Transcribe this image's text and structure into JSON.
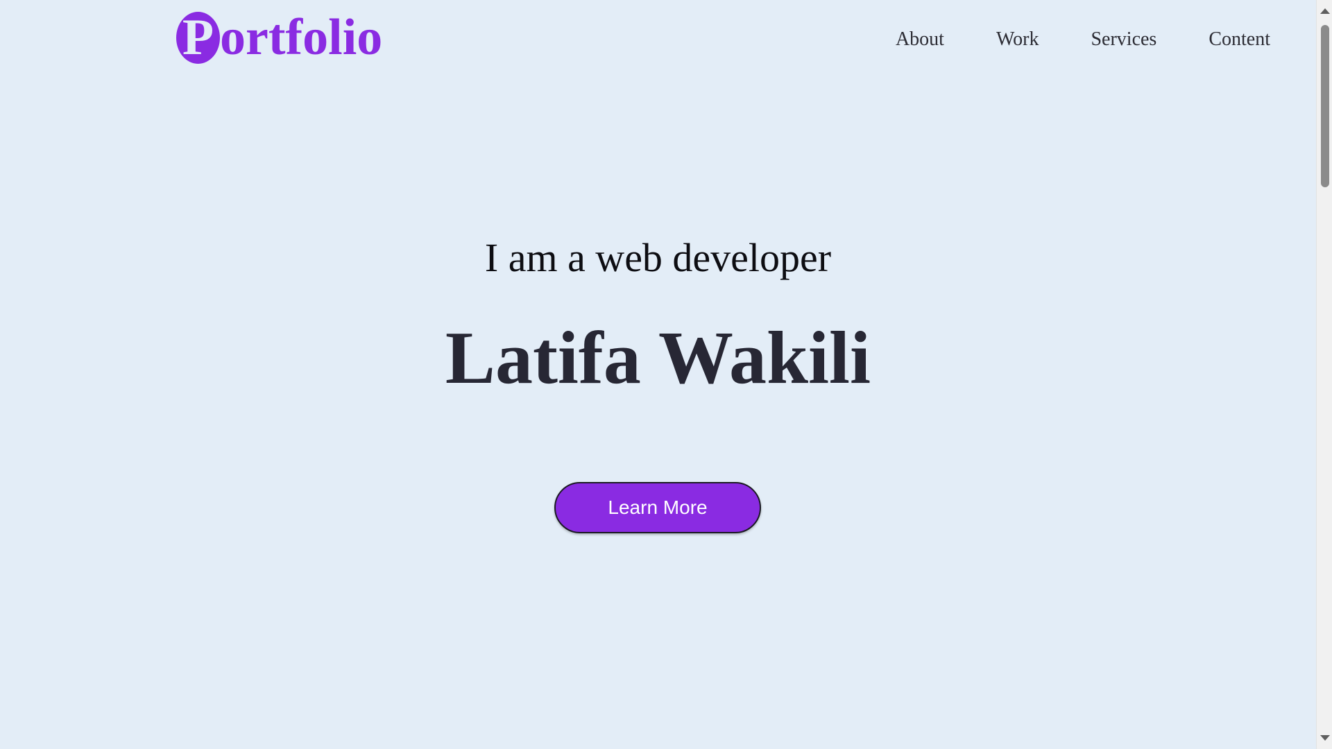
{
  "header": {
    "logo_initial": "P",
    "logo_rest": "ortfolio",
    "nav": [
      {
        "label": "About"
      },
      {
        "label": "Work"
      },
      {
        "label": "Services"
      },
      {
        "label": "Content"
      }
    ]
  },
  "hero": {
    "subtitle": "I am a web developer",
    "name": "Latifa Wakili",
    "cta_label": "Learn More"
  },
  "colors": {
    "background": "#e3edf7",
    "accent": "#8a2be2",
    "text_dark": "#272734"
  }
}
